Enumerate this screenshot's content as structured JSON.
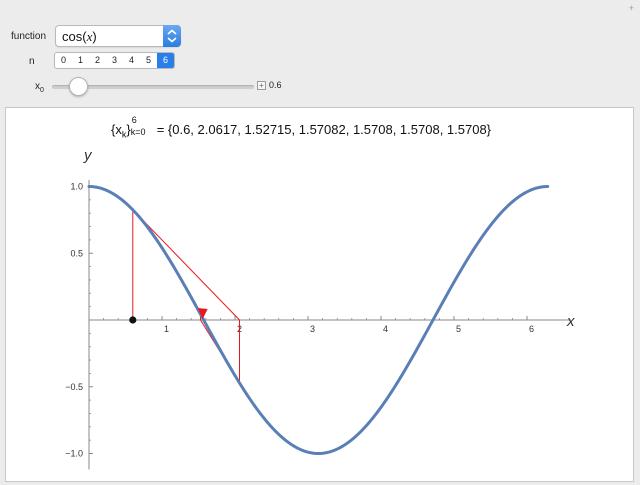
{
  "controls": {
    "function_label": "function",
    "function_name": "cos",
    "function_var": "x",
    "n_label": "n",
    "n_options": [
      "0",
      "1",
      "2",
      "3",
      "4",
      "5",
      "6"
    ],
    "n_selected": "6",
    "x0_label": "x",
    "x0_sub": "0",
    "x0_value": "0.6",
    "plus_glyph": "+"
  },
  "result": {
    "lhs_x": "{x",
    "lhs_k": "k",
    "lhs_close": "}",
    "lhs_sup": "6",
    "lhs_sub": "k=0",
    "rhs": "= {0.6, 2.0617, 1.52715, 1.57082, 1.5708, 1.5708, 1.5708}"
  },
  "chart_data": {
    "type": "line",
    "curve": "cos(x)",
    "xlabel": "x",
    "ylabel": "y",
    "xlim": [
      0,
      6.2832
    ],
    "ylim": [
      -1.0,
      1.0
    ],
    "x_ticks": [
      1,
      2,
      3,
      4,
      5,
      6
    ],
    "y_ticks": [
      1.0,
      0.5,
      -0.5,
      -1.0
    ],
    "x_tick_labels": [
      "1",
      "2",
      "3",
      "4",
      "5",
      "6"
    ],
    "y_tick_labels": [
      "1.0",
      "0.5",
      "−0.5",
      "−1.0"
    ],
    "iterates": [
      0.6,
      2.0617,
      1.52715,
      1.57082,
      1.5708,
      1.5708,
      1.5708
    ],
    "x0": 0.6,
    "colors": {
      "curve": "#5a7fb6",
      "newton": "#e8191e",
      "start_point": "#111111"
    }
  }
}
